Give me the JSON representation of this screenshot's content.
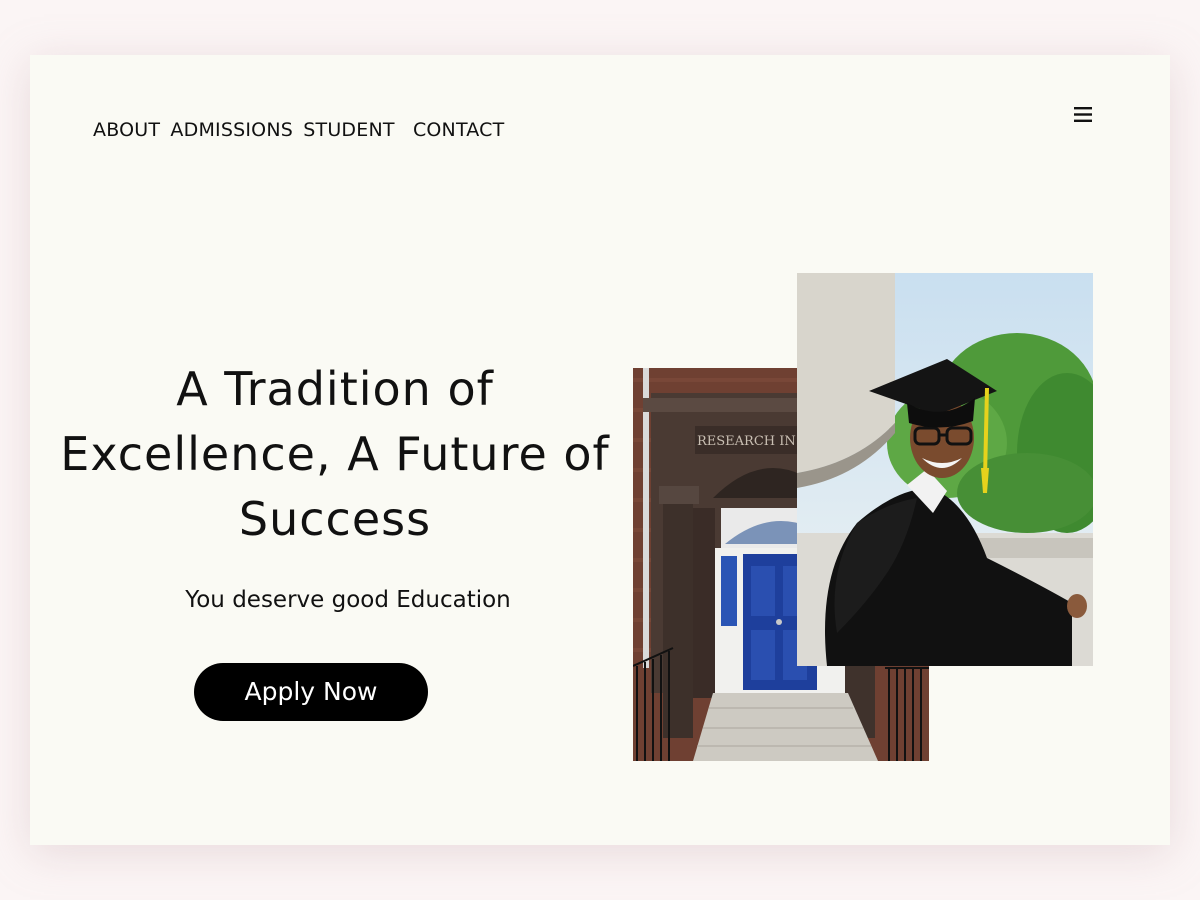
{
  "nav": {
    "items": [
      {
        "label": "ABOUT"
      },
      {
        "label": "ADMISSIONS"
      },
      {
        "label": "STUDENT"
      },
      {
        "label": "CONTACT"
      }
    ],
    "menu_icon": "hamburger-menu-icon"
  },
  "hero": {
    "title": "A Tradition of Excellence, A Future of Success",
    "subtitle": "You deserve good Education",
    "cta_label": "Apply Now"
  },
  "images": {
    "building_sign": "RESEARCH IN"
  },
  "colors": {
    "page_bg": "#fbf5f5",
    "card_bg": "#fafaf4",
    "button_bg": "#000000",
    "button_text": "#ffffff",
    "door_blue": "#1e3f9c"
  }
}
